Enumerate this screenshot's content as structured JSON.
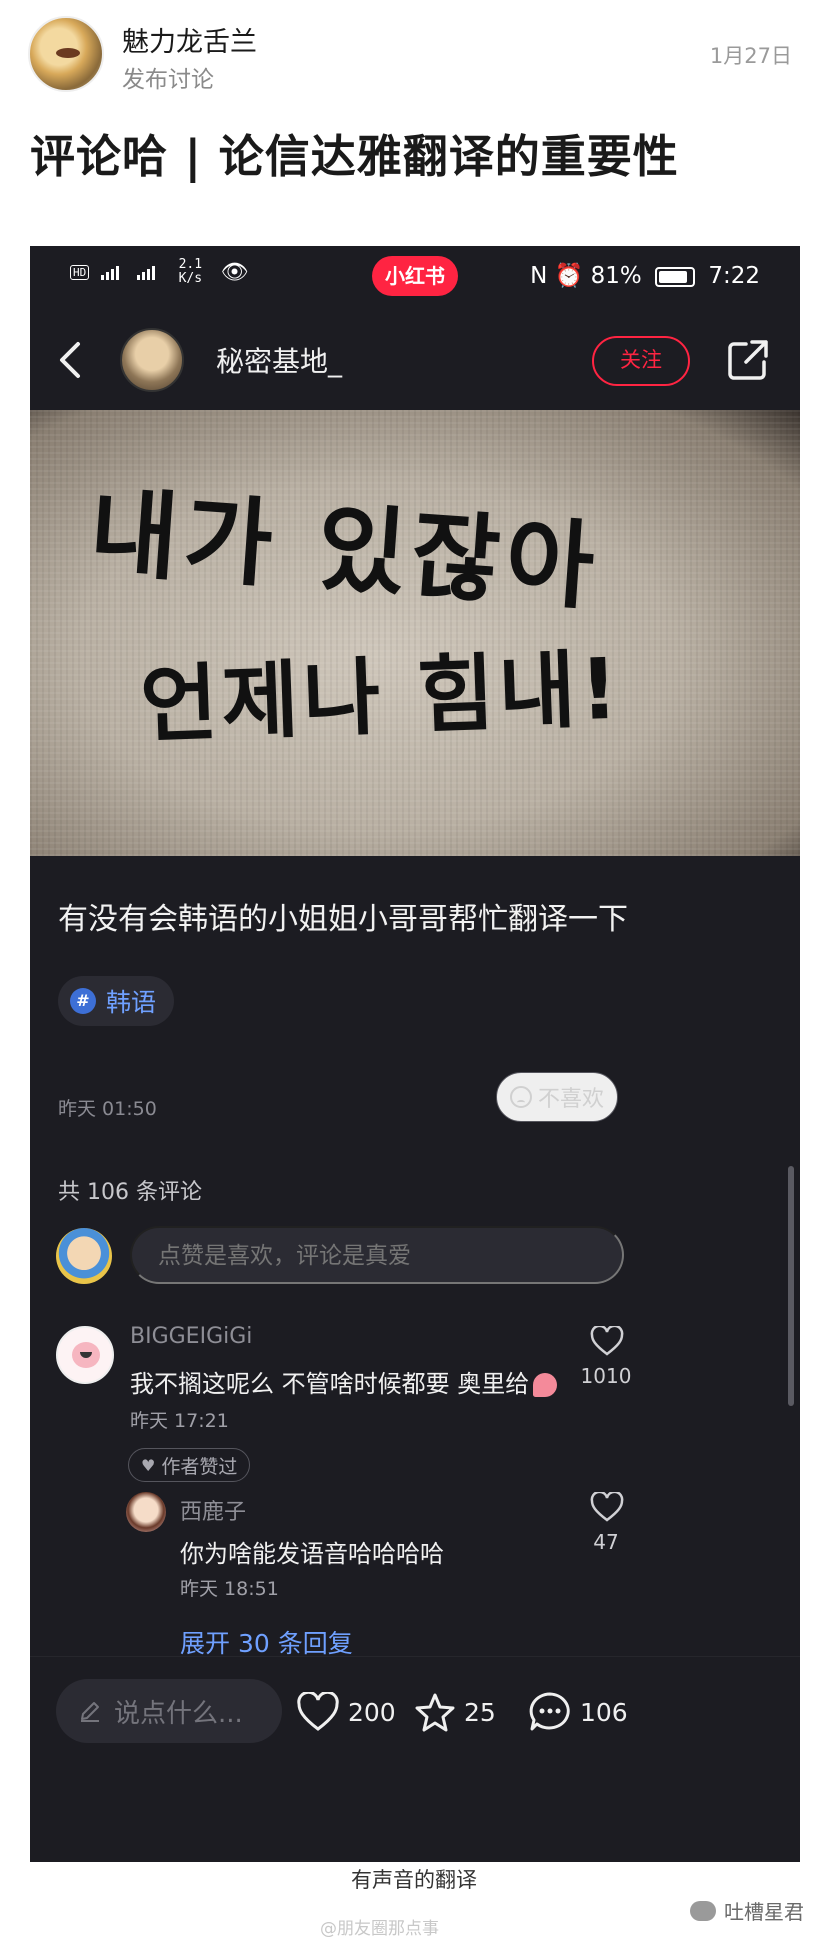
{
  "post": {
    "author": "魅力龙舌兰",
    "action": "发布讨论",
    "date": "1月27日",
    "title": "评论哈 | 论信达雅翻译的重要性"
  },
  "phone": {
    "status": {
      "speed_value": "2.1",
      "speed_unit": "K/s",
      "app_badge": "小红书",
      "battery": "81%",
      "time": "7:22"
    },
    "nav": {
      "username": "秘密基地_",
      "follow_label": "关注"
    },
    "image": {
      "line1": "내가 있잖아",
      "line2": "언제나 힘내!"
    },
    "note": {
      "title": "有没有会韩语的小姐姐小哥哥帮忙翻译一下",
      "tag": "韩语",
      "time": "昨天 01:50",
      "dislike_label": "不喜欢"
    },
    "comments_header": "共 106 条评论",
    "comment_placeholder": "点赞是喜欢，评论是真爱",
    "comment": {
      "user": "BIGGEIGiGi",
      "text": "我不搁这呢么 不管啥时候都要 奥里给",
      "time": "昨天 17:21",
      "author_liked": "作者赞过",
      "likes": "1010"
    },
    "reply": {
      "user": "西鹿子",
      "text": "你为啥能发语音哈哈哈哈",
      "time": "昨天 18:51",
      "likes": "47"
    },
    "expand_label": "展开 30 条回复",
    "bottom": {
      "say_placeholder": "说点什么...",
      "likes": "200",
      "favorites": "25",
      "comments": "106"
    }
  },
  "caption": "有声音的翻译",
  "watermark_weibo": "@朋友圈那点事",
  "watermark_wechat": "吐槽星君",
  "colors": {
    "accent_red": "#ff2442",
    "link_blue": "#6fa0ff",
    "phone_bg": "#1c1c22"
  }
}
